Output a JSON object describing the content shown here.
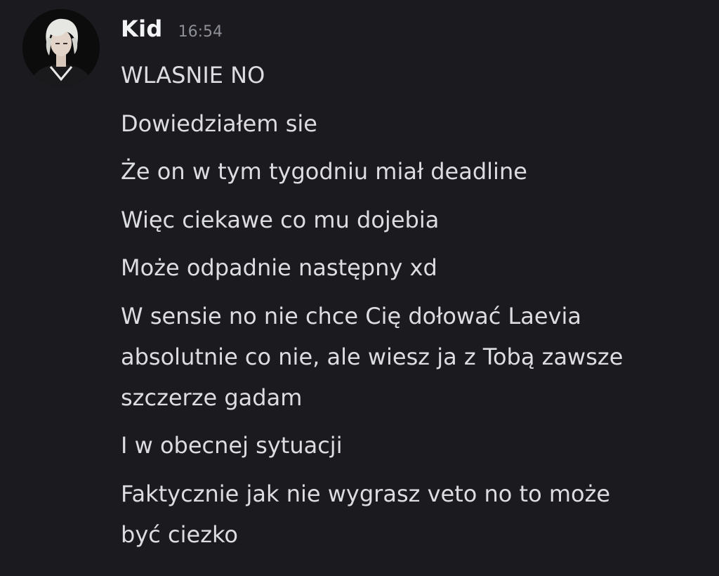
{
  "author": {
    "name": "Kid",
    "timestamp": "16:54"
  },
  "messages": [
    {
      "lines": [
        "WLASNIE NO"
      ]
    },
    {
      "lines": [
        "Dowiedziałem sie"
      ]
    },
    {
      "lines": [
        "Że on w tym tygodniu miał deadline"
      ]
    },
    {
      "lines": [
        "Więc ciekawe co mu dojebia"
      ]
    },
    {
      "lines": [
        "Może odpadnie następny xd"
      ]
    },
    {
      "lines": [
        "W sensie no nie chce Cię dołować Laevia",
        "absolutnie co nie, ale wiesz ja z Tobą zawsze",
        "szczerze gadam"
      ]
    },
    {
      "lines": [
        "I w obecnej sytuacji"
      ]
    },
    {
      "lines": [
        "Faktycznie jak nie wygrasz veto no to może",
        "być ciezko"
      ]
    }
  ],
  "colors": {
    "background": "#1b1a1f",
    "username": "#f2f3f5",
    "timestamp": "#8d8f97",
    "message_text": "#dcdde1"
  }
}
